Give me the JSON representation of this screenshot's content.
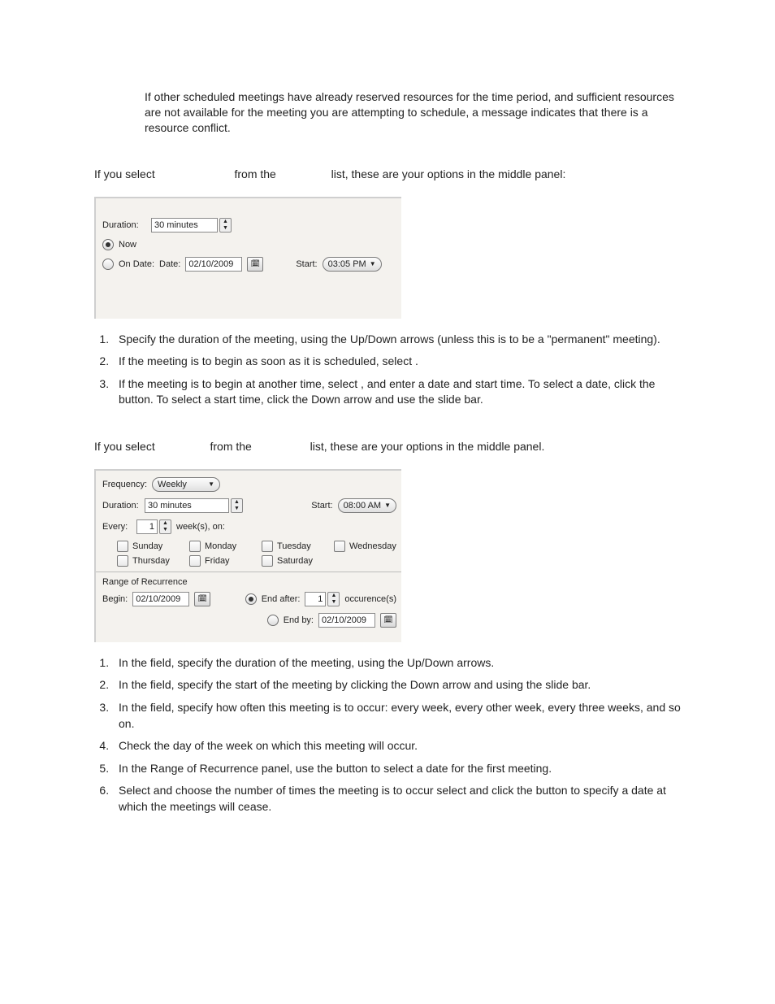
{
  "intro": {
    "p1": "If other scheduled meetings have already reserved resources for the time period, and sufficient resources are not available for the meeting you are attempting to schedule, a message indicates that there is a resource conflict."
  },
  "sectionA": {
    "lead_a": "If you select",
    "lead_b": "from the",
    "lead_c": "list, these are your options in the middle panel:",
    "panel": {
      "duration_label": "Duration:",
      "duration_value": "30 minutes",
      "now_label": "Now",
      "ondate_label": "On Date:",
      "date_label": "Date:",
      "date_value": "02/10/2009",
      "start_label": "Start:",
      "start_value": "03:05 PM"
    },
    "steps": [
      "Specify the duration of the meeting, using the Up/Down arrows (unless this is to be a \"permanent\" meeting).",
      "If the meeting is to begin as soon as it is scheduled, select        .",
      "If the meeting is to begin at another time, select              , and enter a date and start time. To select a date, click the                 button. To select a start time, click the Down arrow and use the slide bar."
    ]
  },
  "sectionB": {
    "lead_a": "If you select",
    "lead_b": "from the",
    "lead_c": "list, these are your options in the middle panel.",
    "panel": {
      "frequency_label": "Frequency:",
      "frequency_value": "Weekly",
      "duration_label": "Duration:",
      "duration_value": "30 minutes",
      "start_label": "Start:",
      "start_value": "08:00 AM",
      "every_label": "Every:",
      "every_value": "1",
      "weeks_on_label": "week(s), on:",
      "days": [
        "Sunday",
        "Monday",
        "Tuesday",
        "Wednesday",
        "Thursday",
        "Friday",
        "Saturday"
      ],
      "range_title": "Range of Recurrence",
      "begin_label": "Begin:",
      "begin_value": "02/10/2009",
      "end_after_label": "End after:",
      "end_after_value": "1",
      "occurrences_label": "occurence(s)",
      "end_by_label": "End by:",
      "end_by_value": "02/10/2009"
    },
    "steps": [
      "In the              field, specify the duration of the meeting, using the Up/Down arrows.",
      "In the           field, specify the start of the meeting by clicking the Down arrow and using the slide bar.",
      "In the           field, specify how often this meeting is to occur: every week, every other week, every three weeks, and so on.",
      "Check the day of the week on which this meeting will occur.",
      "In the Range of Recurrence panel, use the                 button to select a date for the first meeting.",
      "Select                                     and choose the number of times the meeting is to occur      select                and click the                    button to specify a date at which the meetings will cease."
    ]
  }
}
